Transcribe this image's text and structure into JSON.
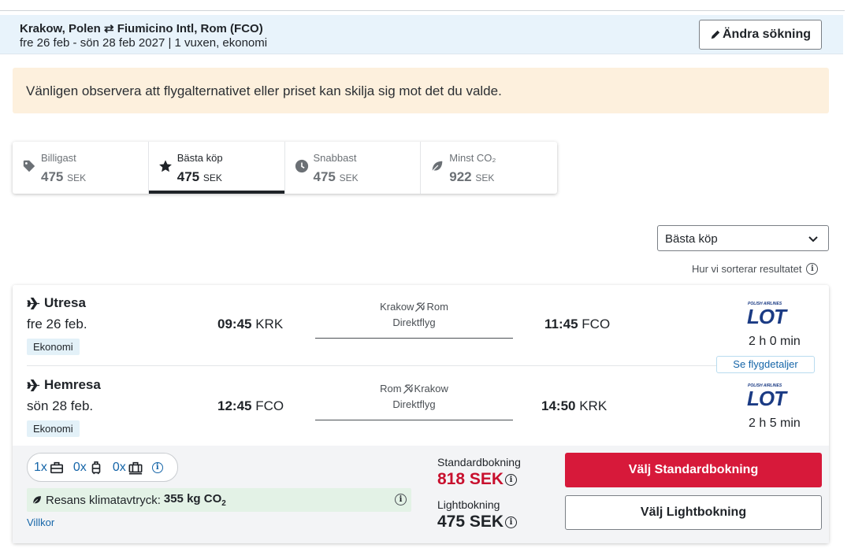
{
  "summary": {
    "route": "Krakow, Polen ⇄ Fiumicino Intl, Rom (FCO)",
    "dates": "fre 26 feb - sön 28 feb 2027  |  1 vuxen, ekonomi",
    "edit_label": "Ändra sökning"
  },
  "notice": "Vänligen observera att flygalternativet eller priset kan skilja sig mot det du valde.",
  "tabs": [
    {
      "label": "Billigast",
      "price": "475",
      "currency": "SEK",
      "icon": "tag-icon"
    },
    {
      "label": "Bästa köp",
      "price": "475",
      "currency": "SEK",
      "icon": "star-icon",
      "active": true
    },
    {
      "label": "Snabbast",
      "price": "475",
      "currency": "SEK",
      "icon": "clock-icon"
    },
    {
      "label": "Minst CO₂",
      "price": "922",
      "currency": "SEK",
      "icon": "leaf-icon"
    }
  ],
  "sort": {
    "selected": "Bästa köp",
    "info_label": "Hur vi sorterar resultatet"
  },
  "outbound": {
    "title": "Utresa",
    "date": "fre 26 feb.",
    "cabin": "Ekonomi",
    "dep_time": "09:45",
    "dep_code": "KRK",
    "from_city": "Krakow",
    "to_city": "Rom",
    "stops": "Direktflyg",
    "arr_time": "11:45",
    "arr_code": "FCO",
    "duration": "2 h 0 min"
  },
  "inbound": {
    "title": "Hemresa",
    "date": "sön 28 feb.",
    "cabin": "Ekonomi",
    "dep_time": "12:45",
    "dep_code": "FCO",
    "from_city": "Rom",
    "to_city": "Krakow",
    "stops": "Direktflyg",
    "arr_time": "14:50",
    "arr_code": "KRK",
    "duration": "2 h 5 min"
  },
  "airline": {
    "small_text": "POLISH AIRLINES",
    "name": "LOT",
    "color": "#1b3b84"
  },
  "details_label": "Se flygdetaljer",
  "bags": {
    "personal": "1x",
    "cabin": "0x",
    "checked": "0x"
  },
  "climate": {
    "label": "Resans klimatavtryck:",
    "value": "355 kg CO",
    "sub": "2"
  },
  "terms_label": "Villkor",
  "fares": {
    "standard_label": "Standardbokning",
    "standard_price": "818 SEK",
    "light_label": "Lightbokning",
    "light_price": "475 SEK",
    "standard_button": "Välj Standardbokning",
    "light_button": "Välj Lightbokning"
  },
  "colors": {
    "accent_red": "#d7193a",
    "price_red": "#c8102e",
    "link_blue": "#1565a8",
    "notice_bg": "#fdf0dd",
    "summary_bg": "#e8f3fb",
    "climate_bg": "#e3f2e6"
  }
}
